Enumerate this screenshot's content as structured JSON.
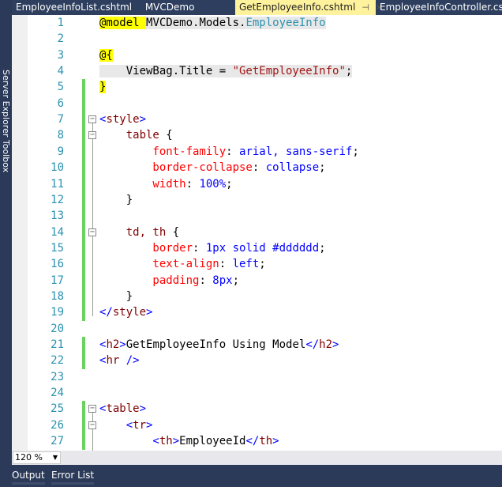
{
  "sidebar": {
    "label": "Server Explorer   Toolbox"
  },
  "tabs": [
    {
      "label": "EmployeeInfoList.cshtml",
      "active": false
    },
    {
      "label": "MVCDemo",
      "active": false
    },
    {
      "label": "GetEmployeeInfo.cshtml",
      "active": true
    },
    {
      "label": "EmployeeInfoController.cs",
      "active": false
    }
  ],
  "colors": {
    "keyword": "#0000ff",
    "tag": "#800000",
    "property": "#ff0000",
    "string": "#a31515",
    "type": "#2b91af",
    "razor_bg": "#ffff00",
    "text": "#000000",
    "change_bar": "#6ad35f",
    "active_tab": "#fff29d"
  },
  "lines": [
    {
      "n": "1",
      "tokens": [
        [
          "@model ",
          "razor"
        ],
        [
          "MVCDemo.Models.",
          "text"
        ],
        [
          "EmployeeInfo",
          "type"
        ]
      ]
    },
    {
      "n": "2",
      "tokens": []
    },
    {
      "n": "3",
      "tokens": [
        [
          "@{",
          "razor"
        ]
      ]
    },
    {
      "n": "4",
      "tokens": [
        [
          "    ViewBag.Title = ",
          "text"
        ],
        [
          "\"GetEmployeeInfo\"",
          "string"
        ],
        [
          ";",
          "text"
        ]
      ]
    },
    {
      "n": "5",
      "tokens": [
        [
          "}",
          "razor"
        ]
      ],
      "chg": true
    },
    {
      "n": "6",
      "tokens": [],
      "chg": true
    },
    {
      "n": "7",
      "tokens": [
        [
          "<",
          "keyword"
        ],
        [
          "style",
          "tag"
        ],
        [
          ">",
          "keyword"
        ]
      ],
      "chg": true,
      "fold": true
    },
    {
      "n": "8",
      "tokens": [
        [
          "    table ",
          "tag"
        ],
        [
          "{",
          "text"
        ]
      ],
      "chg": true,
      "fold": true
    },
    {
      "n": "9",
      "tokens": [
        [
          "        font-family",
          "property"
        ],
        [
          ": ",
          "text"
        ],
        [
          "arial, sans-serif",
          "keyword"
        ],
        [
          ";",
          "text"
        ]
      ],
      "chg": true
    },
    {
      "n": "10",
      "tokens": [
        [
          "        border-collapse",
          "property"
        ],
        [
          ": ",
          "text"
        ],
        [
          "collapse",
          "keyword"
        ],
        [
          ";",
          "text"
        ]
      ],
      "chg": true
    },
    {
      "n": "11",
      "tokens": [
        [
          "        width",
          "property"
        ],
        [
          ": ",
          "text"
        ],
        [
          "100%",
          "keyword"
        ],
        [
          ";",
          "text"
        ]
      ],
      "chg": true
    },
    {
      "n": "12",
      "tokens": [
        [
          "    }",
          "text"
        ]
      ],
      "chg": true
    },
    {
      "n": "13",
      "tokens": [],
      "chg": true
    },
    {
      "n": "14",
      "tokens": [
        [
          "    td, th ",
          "tag"
        ],
        [
          "{",
          "text"
        ]
      ],
      "chg": true,
      "fold": true
    },
    {
      "n": "15",
      "tokens": [
        [
          "        border",
          "property"
        ],
        [
          ": ",
          "text"
        ],
        [
          "1px solid #dddddd",
          "keyword"
        ],
        [
          ";",
          "text"
        ]
      ],
      "chg": true
    },
    {
      "n": "16",
      "tokens": [
        [
          "        text-align",
          "property"
        ],
        [
          ": ",
          "text"
        ],
        [
          "left",
          "keyword"
        ],
        [
          ";",
          "text"
        ]
      ],
      "chg": true
    },
    {
      "n": "17",
      "tokens": [
        [
          "        padding",
          "property"
        ],
        [
          ": ",
          "text"
        ],
        [
          "8px",
          "keyword"
        ],
        [
          ";",
          "text"
        ]
      ],
      "chg": true
    },
    {
      "n": "18",
      "tokens": [
        [
          "    }",
          "text"
        ]
      ],
      "chg": true
    },
    {
      "n": "19",
      "tokens": [
        [
          "</",
          "keyword"
        ],
        [
          "style",
          "tag"
        ],
        [
          ">",
          "keyword"
        ]
      ],
      "chg": true
    },
    {
      "n": "20",
      "tokens": []
    },
    {
      "n": "21",
      "tokens": [
        [
          "<",
          "keyword"
        ],
        [
          "h2",
          "tag"
        ],
        [
          ">",
          "keyword"
        ],
        [
          "GetEmployeeInfo Using Model",
          "text"
        ],
        [
          "</",
          "keyword"
        ],
        [
          "h2",
          "tag"
        ],
        [
          ">",
          "keyword"
        ]
      ],
      "chg": true
    },
    {
      "n": "22",
      "tokens": [
        [
          "<",
          "keyword"
        ],
        [
          "hr",
          "tag"
        ],
        [
          " />",
          "keyword"
        ]
      ],
      "chg": true
    },
    {
      "n": "23",
      "tokens": []
    },
    {
      "n": "24",
      "tokens": []
    },
    {
      "n": "25",
      "tokens": [
        [
          "<",
          "keyword"
        ],
        [
          "table",
          "tag"
        ],
        [
          ">",
          "keyword"
        ]
      ],
      "chg": true,
      "fold": true
    },
    {
      "n": "26",
      "tokens": [
        [
          "    <",
          "keyword"
        ],
        [
          "tr",
          "tag"
        ],
        [
          ">",
          "keyword"
        ]
      ],
      "chg": true,
      "fold": true
    },
    {
      "n": "27",
      "tokens": [
        [
          "        <",
          "keyword"
        ],
        [
          "th",
          "tag"
        ],
        [
          ">",
          "keyword"
        ],
        [
          "EmployeeId",
          "text"
        ],
        [
          "</",
          "keyword"
        ],
        [
          "th",
          "tag"
        ],
        [
          ">",
          "keyword"
        ]
      ],
      "chg": true
    }
  ],
  "zoom": {
    "value": "120 %"
  },
  "panel": {
    "tabs": [
      "Output",
      "Error List"
    ]
  }
}
